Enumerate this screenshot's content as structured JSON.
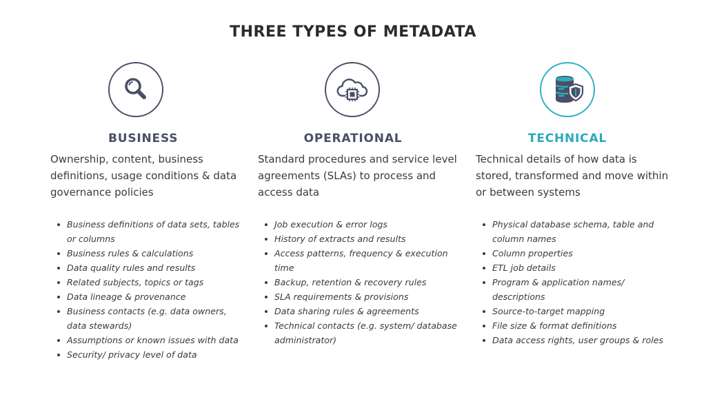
{
  "title": "THREE TYPES OF METADATA",
  "columns": [
    {
      "heading": "BUSINESS",
      "icon": "magnifier-icon",
      "description": "Ownership, content, business definitions, usage conditions & data governance policies",
      "items": [
        "Business definitions of data sets, tables or columns",
        "Business rules & calculations",
        "Data quality rules and results",
        "Related subjects, topics or tags",
        "Data lineage & provenance",
        "Business contacts (e.g. data owners, data stewards)",
        "Assumptions or known issues with data",
        "Security/ privacy level of data"
      ]
    },
    {
      "heading": "OPERATIONAL",
      "icon": "cloud-chip-icon",
      "description": "Standard procedures and service level agreements (SLAs) to process and access data",
      "items": [
        "Job execution & error logs",
        "History of extracts and results",
        "Access patterns, frequency & execution time",
        "Backup, retention & recovery rules",
        "SLA requirements & provisions",
        "Data sharing rules & agreements",
        "Technical contacts (e.g. system/ database administrator)"
      ]
    },
    {
      "heading": "TECHNICAL",
      "icon": "database-shield-icon",
      "description": "Technical details of how data is stored, transformed and move within or between systems",
      "items": [
        "Physical database schema, table and column names",
        "Column properties",
        "ETL job details",
        "Program & application names/ descriptions",
        "Source-to-target mapping",
        "File size & format definitions",
        "Data access rights, user groups & roles"
      ]
    }
  ],
  "colors": {
    "navy": "#4a4f66",
    "teal": "#2bb0bf",
    "text": "#3a3a3a"
  }
}
